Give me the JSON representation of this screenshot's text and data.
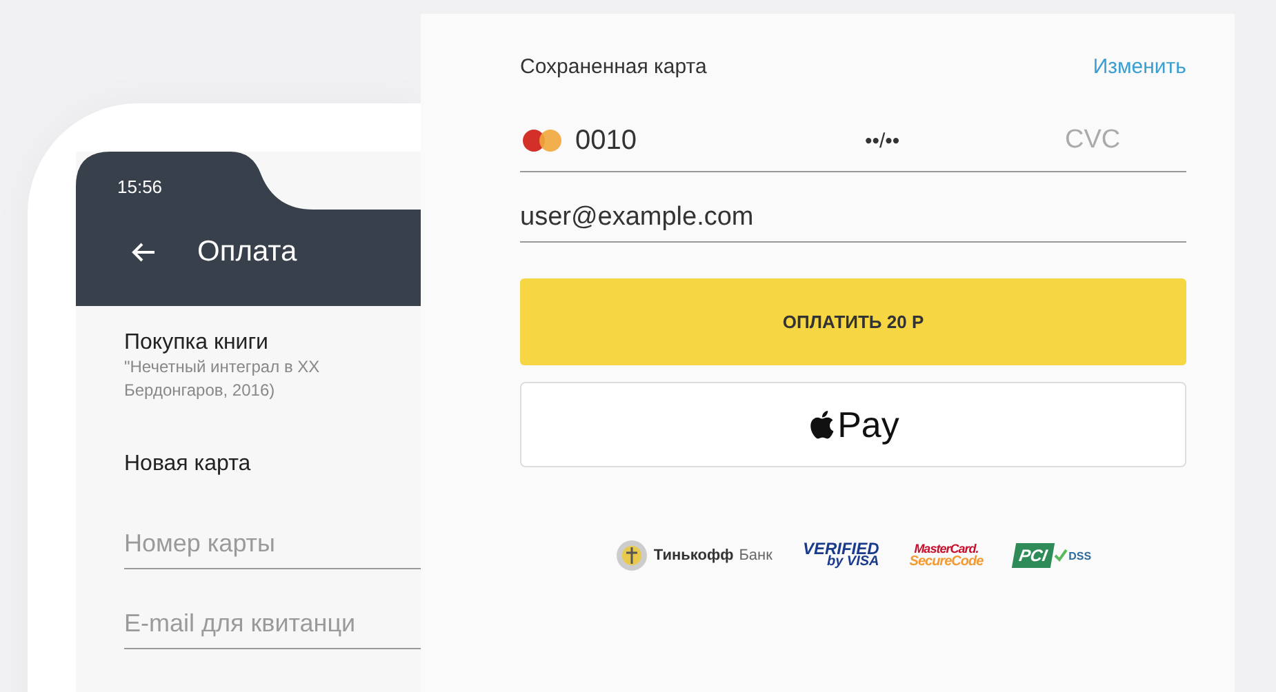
{
  "phone": {
    "status_time": "15:56",
    "title": "Оплата",
    "purchase_title": "Покупка книги",
    "purchase_detail": [
      "\"Нечетный интеграл в XX",
      "Бердонгаров, 2016)"
    ],
    "new_card_label": "Новая карта",
    "fields": [
      {
        "placeholder": "Номер карты"
      },
      {
        "placeholder": "E-mail для квитанци"
      }
    ]
  },
  "payment": {
    "saved_card_label": "Сохраненная карта",
    "change_link": "Изменить",
    "card": {
      "number": "0010",
      "expiry": "••/••",
      "cvc_placeholder": "CVC"
    },
    "email": "user@example.com",
    "pay_button": "ОПЛАТИТЬ 20 Р",
    "apple_pay_button": "Pay",
    "logos": [
      {
        "kind": "tinkoff",
        "texts": [
          "Тинькофф",
          "Банк"
        ]
      },
      {
        "kind": "visa",
        "texts": [
          "VERIFIED",
          "by VISA"
        ]
      },
      {
        "kind": "mastercard",
        "texts": [
          "MasterCard.",
          "SecureCode"
        ]
      },
      {
        "kind": "pci",
        "texts": [
          "PCI",
          "DSS"
        ]
      }
    ]
  }
}
